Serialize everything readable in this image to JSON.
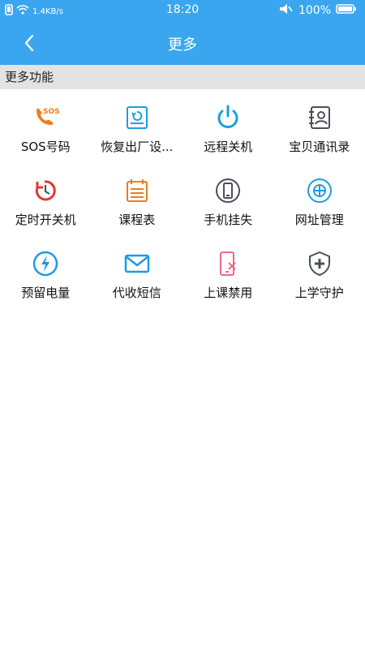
{
  "status_bar": {
    "speed": "1.4KB/s",
    "time": "18:20",
    "battery": "100%"
  },
  "header": {
    "title": "更多"
  },
  "section": {
    "title": "更多功能"
  },
  "features": [
    {
      "label": "SOS号码",
      "icon": "sos-phone-icon"
    },
    {
      "label": "恢复出厂设...",
      "icon": "factory-reset-icon"
    },
    {
      "label": "远程关机",
      "icon": "power-icon"
    },
    {
      "label": "宝贝通讯录",
      "icon": "contacts-icon"
    },
    {
      "label": "定时开关机",
      "icon": "timer-icon"
    },
    {
      "label": "课程表",
      "icon": "calendar-icon"
    },
    {
      "label": "手机挂失",
      "icon": "phone-lost-icon"
    },
    {
      "label": "网址管理",
      "icon": "globe-icon"
    },
    {
      "label": "预留电量",
      "icon": "battery-reserve-icon"
    },
    {
      "label": "代收短信",
      "icon": "sms-icon"
    },
    {
      "label": "上课禁用",
      "icon": "class-disable-icon"
    },
    {
      "label": "上学守护",
      "icon": "guard-icon"
    }
  ],
  "colors": {
    "accent": "#3aa6ef",
    "orange": "#f07c1b",
    "blue": "#1e9be6",
    "gray": "#4a4f5b",
    "red": "#e3392a",
    "pink": "#e86c86"
  }
}
